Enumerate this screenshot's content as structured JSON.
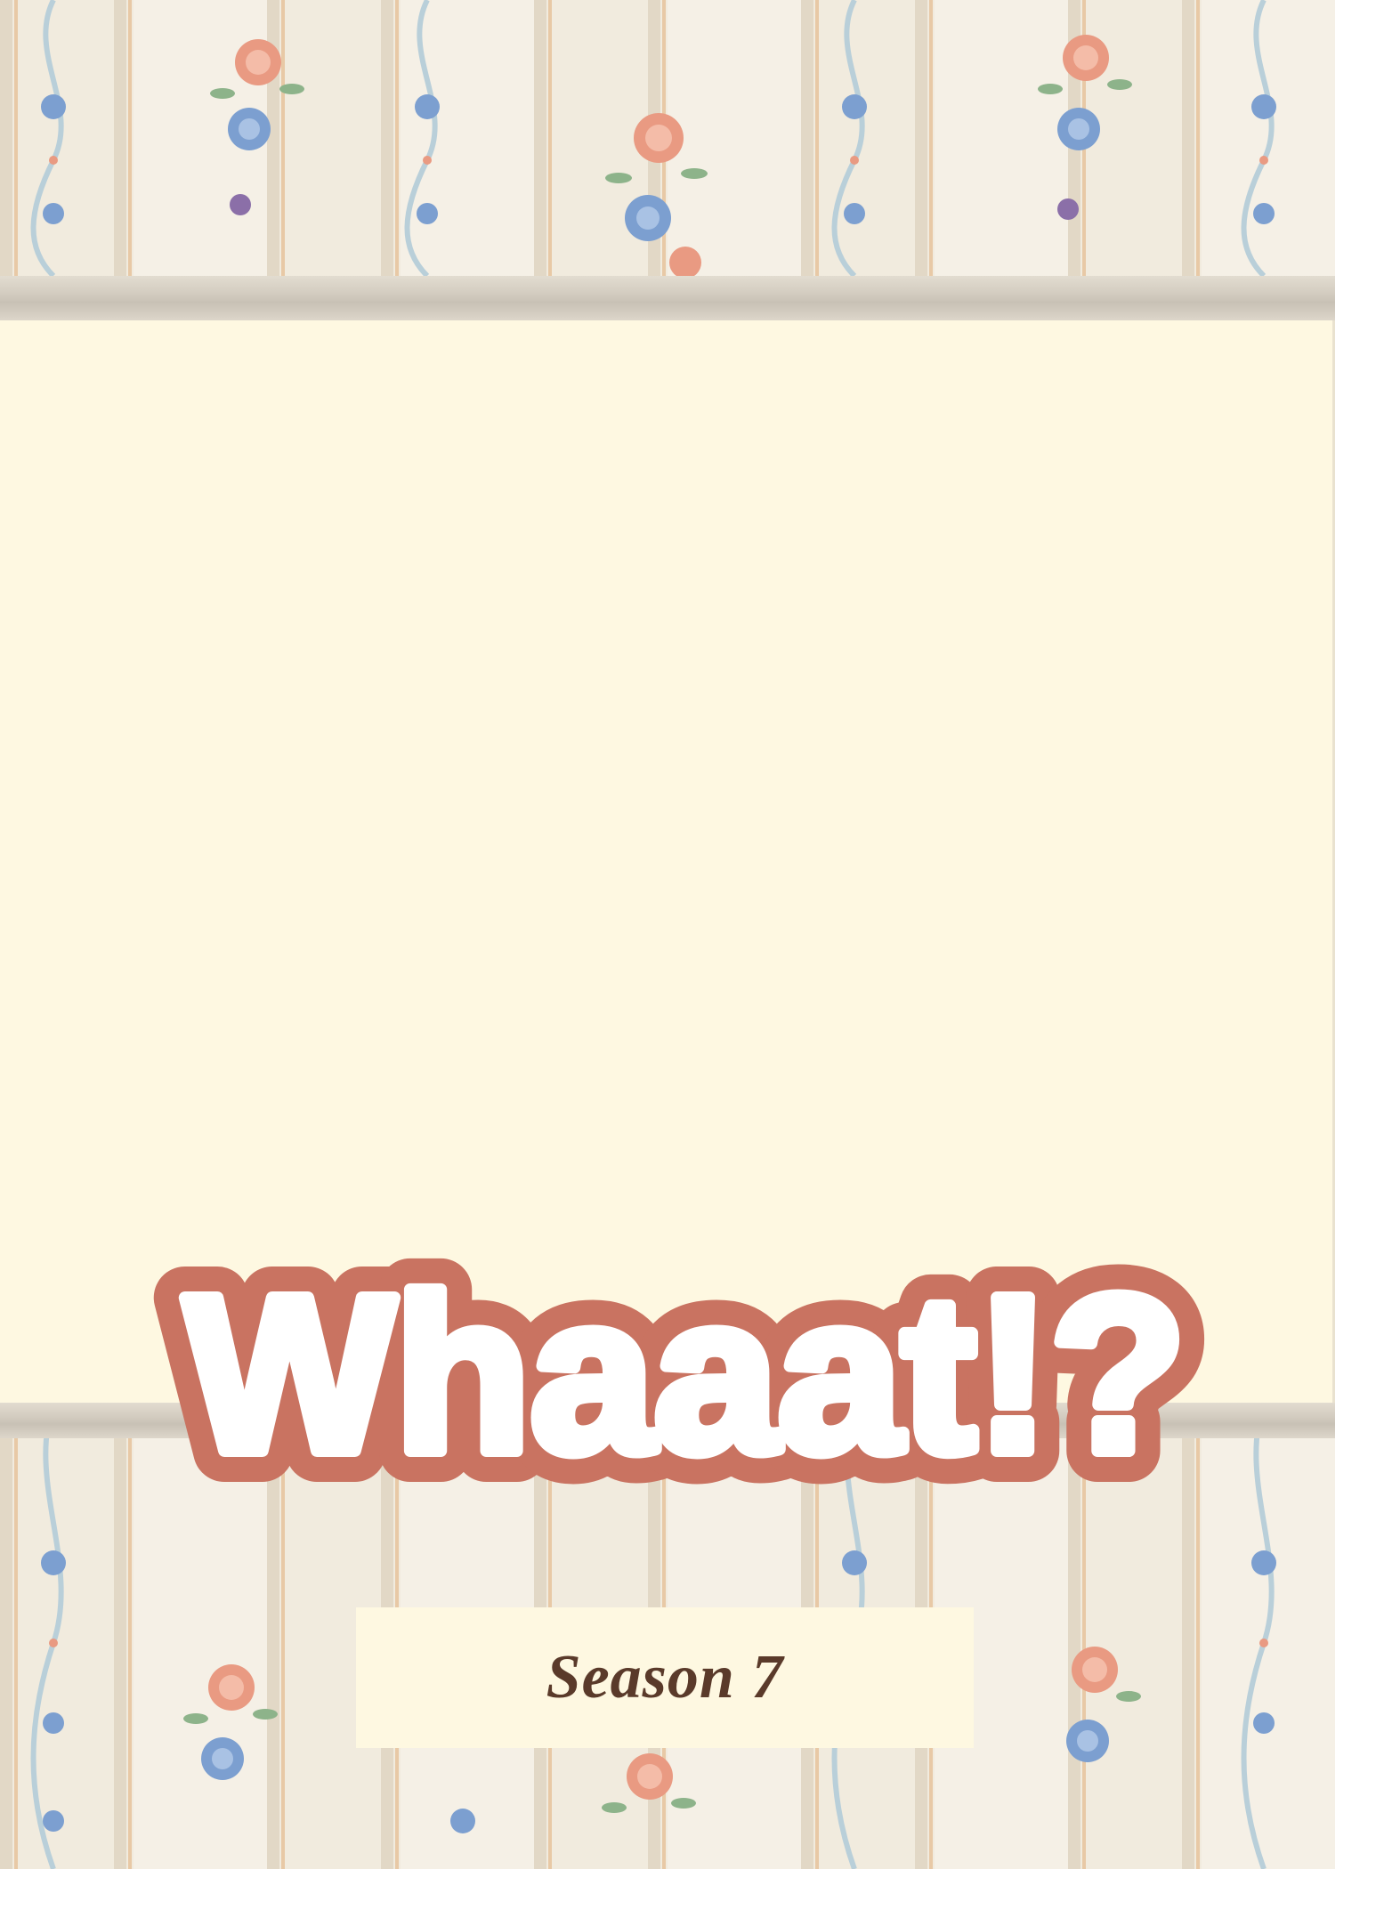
{
  "logo": {
    "text": "Whaaat!?"
  },
  "subtitle": {
    "season_label": "Season 7"
  },
  "colors": {
    "logo_outline": "#c97361",
    "logo_fill": "#ffffff",
    "panel": "#fef8e1",
    "season_text": "#5a3a2a",
    "wallpaper_base": "#efe7da"
  },
  "decor": {
    "pattern": "floral-wallpaper"
  }
}
